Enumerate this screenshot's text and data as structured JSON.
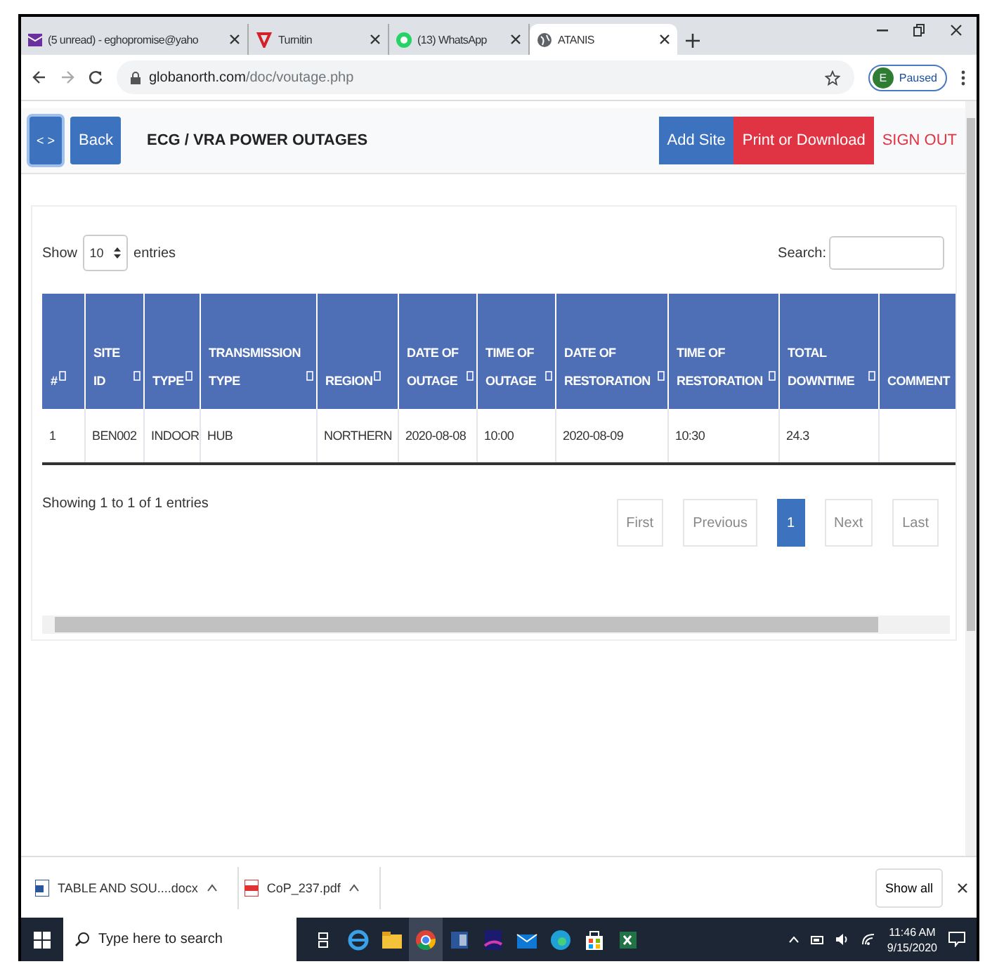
{
  "browser": {
    "tabs": [
      {
        "title": "(5 unread) - eghopromise@yaho",
        "selected": false
      },
      {
        "title": "Turnitin",
        "selected": false
      },
      {
        "title": "(13) WhatsApp",
        "selected": false
      },
      {
        "title": "ATANIS",
        "selected": true
      }
    ],
    "url": {
      "host": "globanorth.com",
      "path": "/doc/voutage.php"
    },
    "profile": {
      "initial": "E",
      "label": "Paused"
    }
  },
  "header": {
    "toggle": "< >",
    "back": "Back",
    "title": "ECG / VRA POWER OUTAGES",
    "actions": [
      {
        "label": "Add Site",
        "kind": "primary"
      },
      {
        "label": "Print or Download",
        "kind": "danger"
      },
      {
        "label": "SIGN OUT",
        "kind": "link"
      }
    ]
  },
  "controls": {
    "show_label": "Show",
    "page_size": "10",
    "entries_label": "entries",
    "search_label": "Search:"
  },
  "table": {
    "columns": [
      "#",
      "SITE ID",
      "TYPE",
      "TRANSMISSION TYPE",
      "REGION",
      "DATE OF OUTAGE",
      "TIME OF OUTAGE",
      "DATE OF RESTORATION",
      "TIME OF RESTORATION",
      "TOTAL DOWNTIME",
      "COMMENT"
    ],
    "rows": [
      [
        "1",
        "BEN002",
        "INDOOR",
        "HUB",
        "NORTHERN",
        "2020-08-08",
        "10:00",
        "2020-08-09",
        "10:30",
        "24.3",
        ""
      ]
    ]
  },
  "info": "Showing 1 to 1 of 1 entries",
  "pagination": [
    {
      "label": "First",
      "selected": false
    },
    {
      "label": "Previous",
      "selected": false
    },
    {
      "label": "1",
      "selected": true
    },
    {
      "label": "Next",
      "selected": false
    },
    {
      "label": "Last",
      "selected": false
    }
  ],
  "downloads": {
    "items": [
      {
        "name": "TABLE AND SOU....docx",
        "kind": "docx"
      },
      {
        "name": "CoP_237.pdf",
        "kind": "pdf"
      }
    ],
    "show_all": "Show all"
  },
  "taskbar": {
    "search_placeholder": "Type here to search",
    "apps": [
      {
        "kind": "taskview",
        "selected": false
      },
      {
        "kind": "ie",
        "selected": false
      },
      {
        "kind": "folder",
        "selected": false
      },
      {
        "kind": "chrome",
        "selected": true
      },
      {
        "kind": "word",
        "selected": false
      },
      {
        "kind": "app",
        "selected": false
      },
      {
        "kind": "mail",
        "selected": false
      },
      {
        "kind": "edge",
        "selected": false
      },
      {
        "kind": "store",
        "selected": false
      },
      {
        "kind": "excel",
        "selected": false
      }
    ],
    "time": "11:46 AM",
    "date": "9/15/2020"
  }
}
